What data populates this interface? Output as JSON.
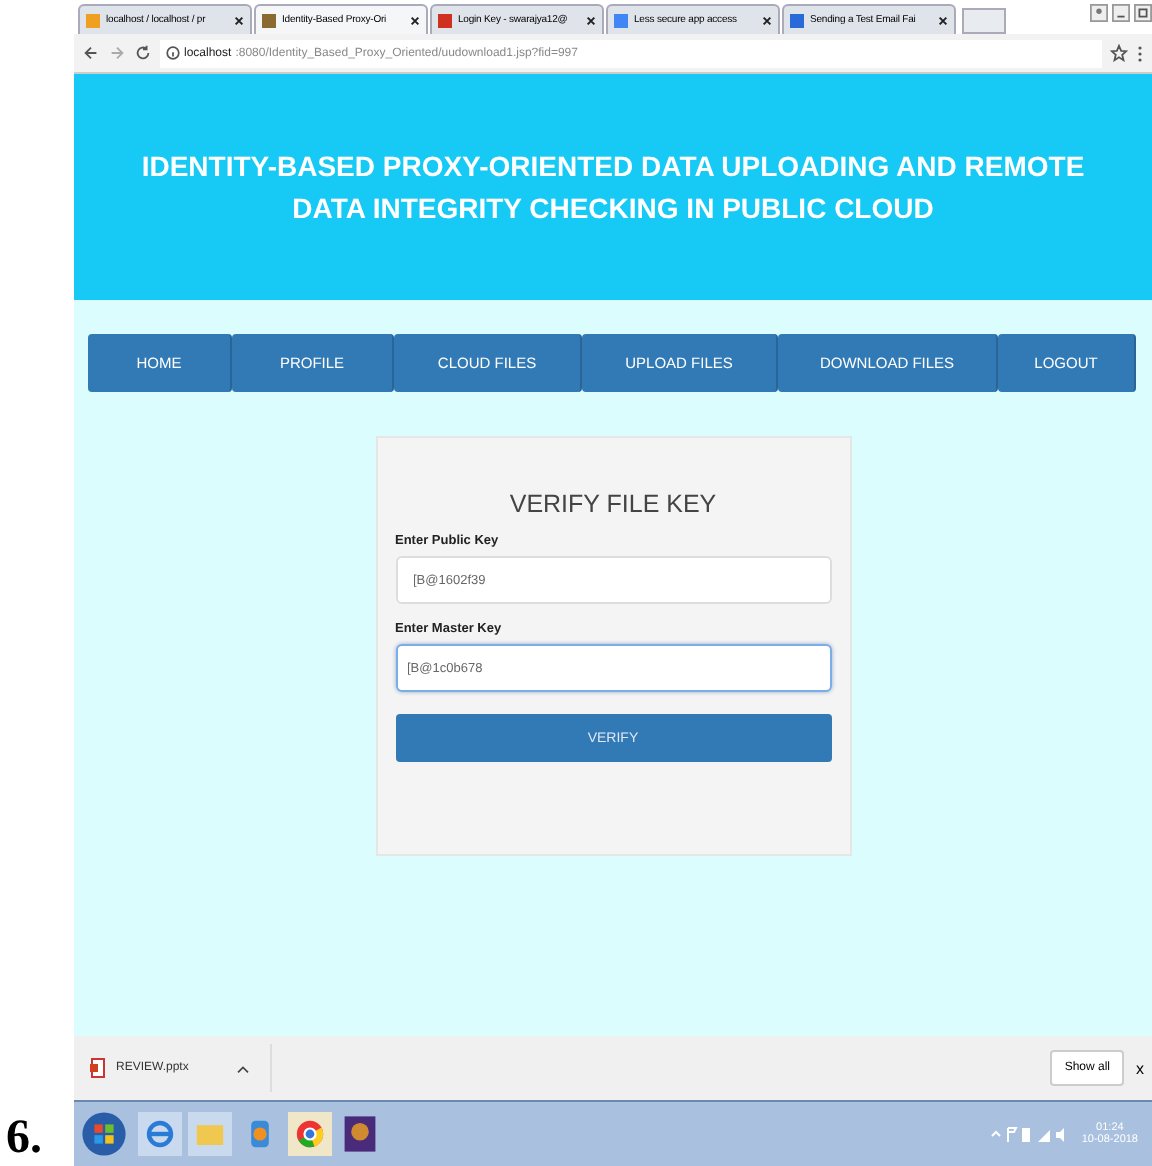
{
  "doc_label": "6.",
  "browser": {
    "tabs": [
      {
        "title": "localhost / localhost / pr",
        "selected": false,
        "color": "#f0a020"
      },
      {
        "title": "Identity-Based Proxy-Ori",
        "selected": true,
        "color": "#8a6a30"
      },
      {
        "title": "Login Key - swarajya12@",
        "selected": false,
        "color": "#d03020"
      },
      {
        "title": "Less secure app access",
        "selected": false,
        "color": "#4285f4"
      },
      {
        "title": "Sending a Test Email Fai",
        "selected": false,
        "color": "#2a6ad8"
      }
    ],
    "url_host": "localhost",
    "url_path": ":8080/Identity_Based_Proxy_Oriented/uudownload1.jsp?fid=997"
  },
  "header": {
    "title": "IDENTITY-BASED PROXY-ORIENTED DATA UPLOADING AND REMOTE DATA INTEGRITY CHECKING IN PUBLIC CLOUD"
  },
  "nav": [
    "HOME",
    "PROFILE",
    "CLOUD FILES",
    "UPLOAD FILES",
    "DOWNLOAD FILES",
    "LOGOUT"
  ],
  "form": {
    "title": "VERIFY FILE KEY",
    "fields": [
      {
        "label": "Enter Public Key",
        "value": "[B@1602f39",
        "focused": false
      },
      {
        "label": "Enter Master Key",
        "value": "[B@1c0b678",
        "focused": true
      }
    ],
    "button": "VERIFY"
  },
  "downloads": {
    "items": [
      {
        "name": "REVIEW.pptx"
      }
    ],
    "show_all": "Show all",
    "close": "x"
  },
  "taskbar": {
    "time": "01:24",
    "date": "10-08-2018"
  }
}
